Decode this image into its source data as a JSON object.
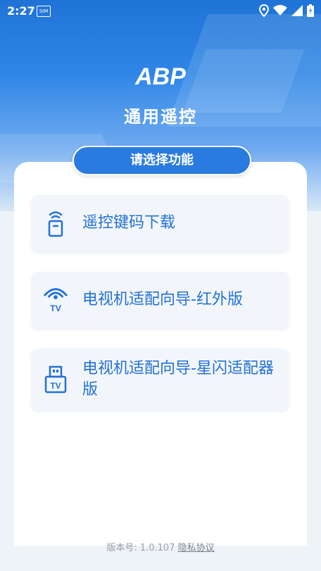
{
  "status_bar": {
    "time": "2:27",
    "sim_icon": "sim-card-icon",
    "icons": [
      "location-icon",
      "wifi-icon",
      "signal-icon",
      "battery-icon"
    ]
  },
  "app": {
    "logo_text": "ABP",
    "title": "通用遥控"
  },
  "section": {
    "title": "请选择功能"
  },
  "menu": [
    {
      "label": "遥控键码下载",
      "icon": "remote-download-icon"
    },
    {
      "label": "电视机适配向导-红外版",
      "icon": "tv-infrared-icon"
    },
    {
      "label": "电视机适配向导-星闪适配器版",
      "icon": "tv-adapter-icon"
    }
  ],
  "footer": {
    "version": "版本号: 1.0.107",
    "privacy": "隐私协议"
  },
  "colors": {
    "primary": "#2a7be0",
    "accent_text": "#2371d6",
    "footer_text": "#9a9fa6"
  }
}
